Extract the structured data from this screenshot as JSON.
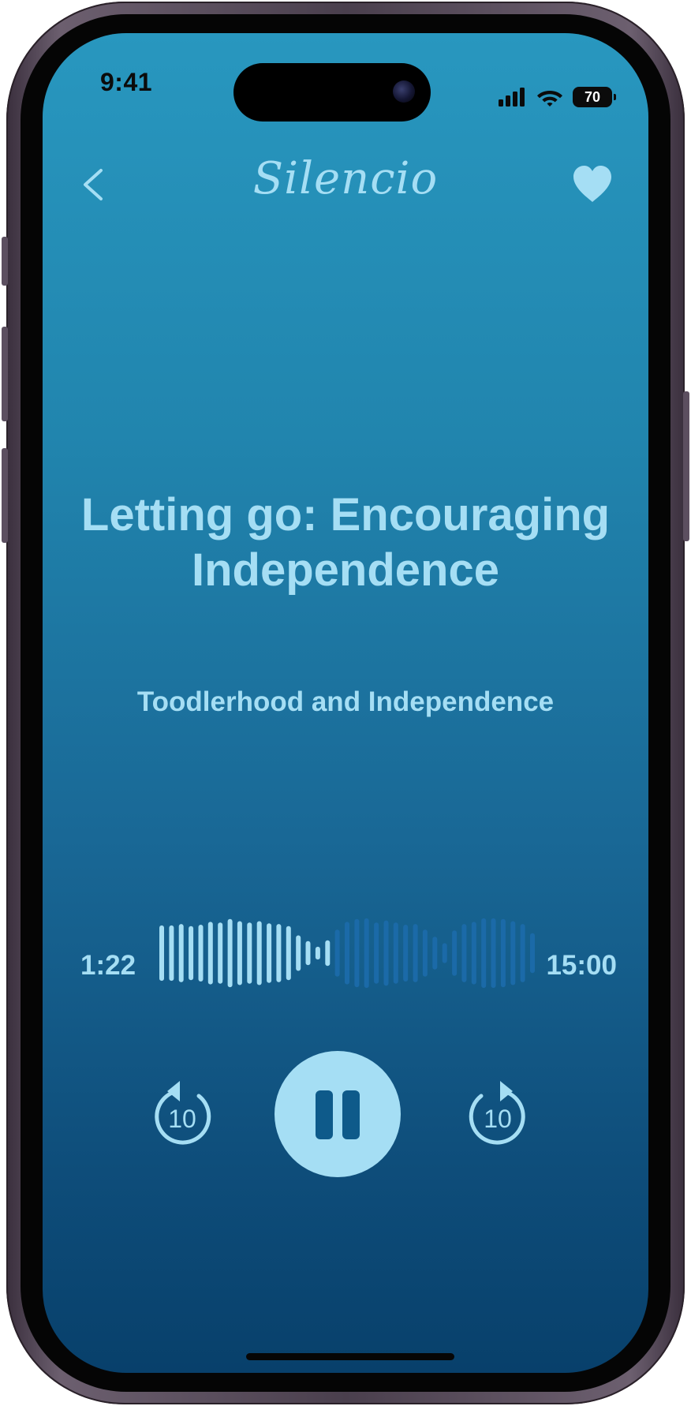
{
  "status_bar": {
    "time": "9:41",
    "battery": "70",
    "icons": [
      "cellular-signal-icon",
      "wifi-icon",
      "battery-icon"
    ]
  },
  "nav": {
    "app_name": "Silencio",
    "back_icon": "chevron-left-icon",
    "favorite_icon": "heart-icon"
  },
  "track": {
    "title": "Letting go: Encouraging Independence",
    "subtitle": "Toodlerhood and Independence"
  },
  "player": {
    "elapsed": "1:22",
    "duration": "15:00",
    "progress": 0.46,
    "skip_back_label": "10",
    "skip_forward_label": "10",
    "state_icon": "pause-icon",
    "waveform_levels": [
      0.78,
      0.78,
      0.82,
      0.76,
      0.8,
      0.88,
      0.86,
      0.96,
      0.9,
      0.86,
      0.9,
      0.84,
      0.82,
      0.76,
      0.5,
      0.34,
      0.18,
      0.36,
      0.66,
      0.88,
      0.96,
      0.98,
      0.86,
      0.92,
      0.86,
      0.8,
      0.82,
      0.66,
      0.46,
      0.28,
      0.64,
      0.82,
      0.88,
      0.98,
      0.98,
      0.96,
      0.9,
      0.82,
      0.56
    ]
  },
  "colors": {
    "accent": "#a5def4",
    "wave_played": "#a5def4",
    "wave_unplayed": "#1b6aa8",
    "bg_top": "#2897bf",
    "bg_bottom": "#08406b",
    "pause_icon": "#0e5a8a"
  }
}
